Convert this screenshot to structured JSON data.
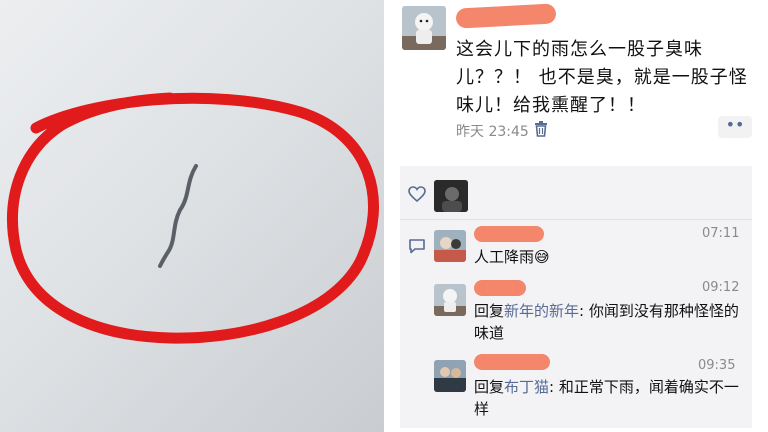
{
  "post": {
    "text": "这会儿下的雨怎么一股子臭味儿？？！ 也不是臭，就是一股子怪味儿！给我熏醒了！！",
    "time": "昨天 23:45",
    "more_label": "••"
  },
  "comments": [
    {
      "time": "07:11",
      "text": "人工降雨",
      "emoji": "😅"
    },
    {
      "time": "09:12",
      "prefix": "回复",
      "reply_to": "新年的新年",
      "text": ": 你闻到没有那种怪怪的味道"
    },
    {
      "time": "09:35",
      "prefix": "回复",
      "reply_to": "布丁猫",
      "text": ": 和正常下雨，闻着确实不一样"
    }
  ],
  "icons": {
    "like": "heart-outline-icon",
    "comment": "speech-bubble-icon",
    "delete": "trash-icon"
  },
  "colors": {
    "link": "#576b95",
    "red_circle": "#e11b1b",
    "redaction": "#f4866b"
  }
}
